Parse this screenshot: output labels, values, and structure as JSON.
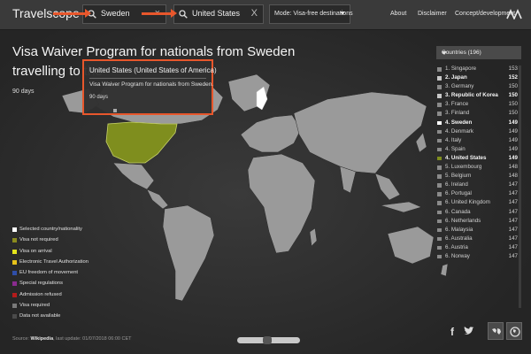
{
  "app": {
    "brand": "Travelscope"
  },
  "search": {
    "from": {
      "value": "Sweden",
      "clear": "×"
    },
    "to": {
      "value": "United States",
      "clear": "X"
    }
  },
  "mode": {
    "label": "Mode: Visa-free destinations"
  },
  "nav": {
    "about": "About",
    "disclaimer": "Disclaimer",
    "concept": "Concept/development"
  },
  "headline": {
    "line1": "Visa Waiver Program for nationals from Sweden",
    "line2": "travelling to the",
    "duration": "90 days"
  },
  "tooltip": {
    "title": "United States (United States of America)",
    "body": "Visa Waiver Program for nationals from Sweden.",
    "duration": "90 days"
  },
  "legend": [
    {
      "label": "Selected country/nationality",
      "color": "#ffffff"
    },
    {
      "label": "Visa not required",
      "color": "#8a8a1e"
    },
    {
      "label": "Visa on arrival",
      "color": "#e3e31c"
    },
    {
      "label": "Electronic Travel Authorization",
      "color": "#e6c21a"
    },
    {
      "label": "EU freedom of movement",
      "color": "#2f4ea8"
    },
    {
      "label": "Special regulations",
      "color": "#8a2b8f"
    },
    {
      "label": "Admission refused",
      "color": "#b31b1b"
    },
    {
      "label": "Visa required",
      "color": "#7a7a7a"
    },
    {
      "label": "Data not available",
      "color": "#4a4a4a"
    }
  ],
  "countries": {
    "header": "Countries (196)",
    "items": [
      {
        "label": "1. Singapore",
        "count": "153",
        "color": "#8a8a8a",
        "bold": false
      },
      {
        "label": "2. Japan",
        "count": "152",
        "color": "#c7c7c7",
        "bold": true
      },
      {
        "label": "3. Germany",
        "count": "150",
        "color": "#8a8a8a",
        "bold": false
      },
      {
        "label": "3. Republic of Korea",
        "count": "150",
        "color": "#c7c7c7",
        "bold": true
      },
      {
        "label": "3. France",
        "count": "150",
        "color": "#8a8a8a",
        "bold": false
      },
      {
        "label": "3. Finland",
        "count": "150",
        "color": "#8a8a8a",
        "bold": false
      },
      {
        "label": "4. Sweden",
        "count": "149",
        "color": "#ffffff",
        "bold": true
      },
      {
        "label": "4. Denmark",
        "count": "149",
        "color": "#8a8a8a",
        "bold": false
      },
      {
        "label": "4. Italy",
        "count": "149",
        "color": "#8a8a8a",
        "bold": false
      },
      {
        "label": "4. Spain",
        "count": "149",
        "color": "#8a8a8a",
        "bold": false
      },
      {
        "label": "4. United States",
        "count": "149",
        "color": "#7f8e1e",
        "bold": true
      },
      {
        "label": "5. Luxembourg",
        "count": "148",
        "color": "#8a8a8a",
        "bold": false
      },
      {
        "label": "5. Belgium",
        "count": "148",
        "color": "#8a8a8a",
        "bold": false
      },
      {
        "label": "6. Ireland",
        "count": "147",
        "color": "#8a8a8a",
        "bold": false
      },
      {
        "label": "6. Portugal",
        "count": "147",
        "color": "#8a8a8a",
        "bold": false
      },
      {
        "label": "6. United Kingdom",
        "count": "147",
        "color": "#8a8a8a",
        "bold": false
      },
      {
        "label": "6. Canada",
        "count": "147",
        "color": "#8a8a8a",
        "bold": false
      },
      {
        "label": "6. Netherlands",
        "count": "147",
        "color": "#8a8a8a",
        "bold": false
      },
      {
        "label": "6. Malaysia",
        "count": "147",
        "color": "#8a8a8a",
        "bold": false
      },
      {
        "label": "6. Australia",
        "count": "147",
        "color": "#8a8a8a",
        "bold": false
      },
      {
        "label": "6. Austria",
        "count": "147",
        "color": "#8a8a8a",
        "bold": false
      },
      {
        "label": "6. Norway",
        "count": "147",
        "color": "#8a8a8a",
        "bold": false
      }
    ]
  },
  "footer": {
    "source_label": "Source:",
    "source_link": "Wikipedia",
    "updated": ", last update: 01/07/2018 06:00 CET"
  },
  "share": {
    "facebook": "f"
  },
  "colors": {
    "accent": "#e8572c",
    "selected_destination": "#8a8a1e"
  }
}
